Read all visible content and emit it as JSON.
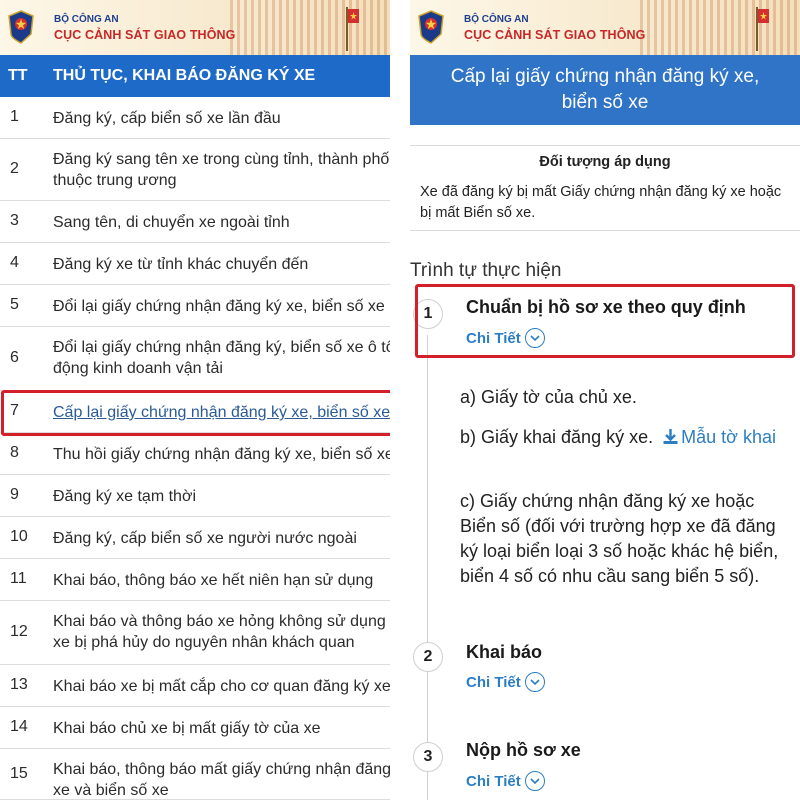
{
  "header": {
    "agency": "BỘ CÔNG AN",
    "department": "CỤC CẢNH SÁT GIAO THÔNG"
  },
  "left_table": {
    "col_stt": "TT",
    "col_title": "THỦ TỤC, KHAI BÁO ĐĂNG KÝ XE",
    "rows": [
      {
        "num": "1",
        "line1": "Đăng ký, cấp biển số xe lần đầu",
        "line2": ""
      },
      {
        "num": "2",
        "line1": "Đăng ký sang tên xe trong cùng tỉnh, thành phố",
        "line2": "thuộc trung ương"
      },
      {
        "num": "3",
        "line1": "Sang tên, di chuyển xe ngoài tỉnh",
        "line2": ""
      },
      {
        "num": "4",
        "line1": "Đăng ký xe từ tỉnh khác chuyển đến",
        "line2": ""
      },
      {
        "num": "5",
        "line1": "Đổi lại giấy chứng nhận đăng ký xe, biển số xe",
        "line2": ""
      },
      {
        "num": "6",
        "line1": "Đổi lại giấy chứng nhận đăng ký, biển số xe ô tô",
        "line2": "động kinh doanh vận tải"
      },
      {
        "num": "7",
        "line1": "Cấp lại giấy chứng nhận đăng ký xe, biển số xe",
        "line2": ""
      },
      {
        "num": "8",
        "line1": "Thu hồi giấy chứng nhận đăng ký xe, biển số xe",
        "line2": ""
      },
      {
        "num": "9",
        "line1": "Đăng ký xe tạm thời",
        "line2": ""
      },
      {
        "num": "10",
        "line1": "Đăng ký, cấp biển số xe người nước ngoài",
        "line2": ""
      },
      {
        "num": "11",
        "line1": "Khai báo, thông báo xe hết niên hạn sử dụng",
        "line2": ""
      },
      {
        "num": "12",
        "line1": "Khai báo và thông báo xe hỏng không sử dụng",
        "line2": "xe bị phá hủy do nguyên nhân khách quan"
      },
      {
        "num": "13",
        "line1": "Khai báo xe bị mất cắp cho cơ quan đăng ký xe",
        "line2": ""
      },
      {
        "num": "14",
        "line1": "Khai báo chủ xe bị mất giấy tờ của xe",
        "line2": ""
      },
      {
        "num": "15",
        "line1": "Khai báo, thông báo mất giấy chứng nhận đăng",
        "line2": "xe và biển số xe"
      }
    ]
  },
  "right_page": {
    "title_line1": "Cấp lại giấy chứng nhận đăng ký xe,",
    "title_line2": "biển số xe",
    "applicable_title": "Đối tượng áp dụng",
    "applicable_text": "Xe đã đăng ký bị mất Giấy chứng nhận đăng ký xe hoặc bị mất Biển số xe.",
    "sequence_title": "Trình tự thực hiện",
    "detail_label": "Chi Tiết",
    "steps": [
      {
        "num": "1",
        "title": "Chuẩn bị hồ sơ xe theo quy định"
      },
      {
        "num": "2",
        "title": "Khai báo"
      },
      {
        "num": "3",
        "title": "Nộp hồ sơ xe"
      }
    ],
    "step1_items": {
      "a": "a) Giấy tờ của chủ xe.",
      "b": "b) Giấy khai đăng ký xe.",
      "b_link": "Mẫu tờ khai",
      "c": "c) Giấy chứng nhận đăng ký xe hoặc Biển số (đối với trường hợp xe đã đăng ký loại biển loại 3 số hoặc khác hệ biển, biển 4 số có nhu cầu sang biển 5 số)."
    }
  },
  "colors": {
    "header_blue": "#1e6ac8",
    "title_blue": "#2f74c7",
    "highlight_red": "#d21f2a",
    "link_blue": "#2c7ec4"
  }
}
